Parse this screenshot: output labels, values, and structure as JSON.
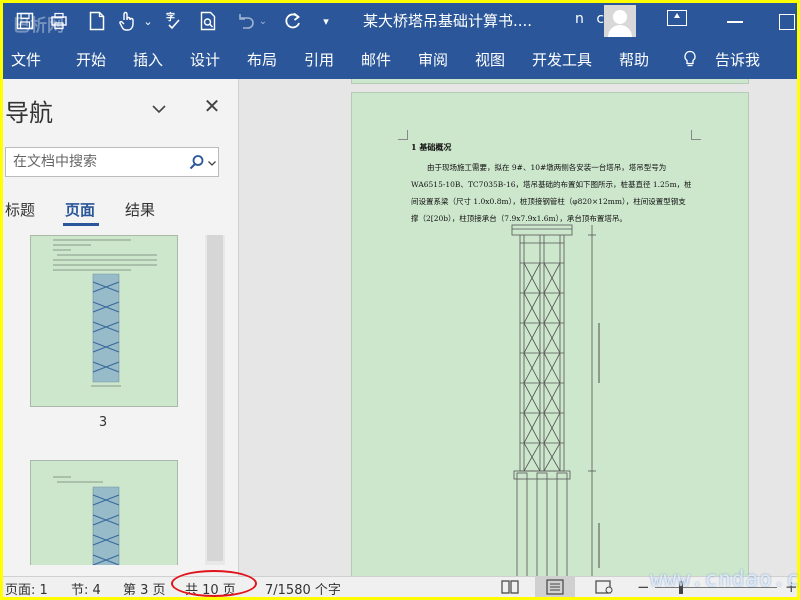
{
  "titlebar": {
    "doc_title": "某大桥塔吊基础计算书....",
    "user_name": "n c",
    "watermark_top": "巴析网"
  },
  "ribbon": {
    "tabs": [
      "文件",
      "开始",
      "插入",
      "设计",
      "布局",
      "引用",
      "邮件",
      "审阅",
      "视图",
      "开发工具",
      "帮助"
    ],
    "tell_me": "告诉我"
  },
  "nav": {
    "title": "导航",
    "search_placeholder": "在文档中搜索",
    "tabs": {
      "headings": "标题",
      "pages": "页面",
      "results": "结果"
    },
    "thumb_page_label": "3"
  },
  "document": {
    "section_heading": "1 基础概况",
    "para_lines": [
      "由于现场施工需要，拟在 9#、10#墩两侧各安装一台塔吊，塔吊型号为",
      "WA6515-10B、TC7035B-16，塔吊基础的布置如下图所示，桩基直径 1.25m，桩",
      "间设置系梁（尺寸 1.0x0.8m），桩顶接钢管柱（φ820×12mm），柱间设置型钢支",
      "撑（2[20b），柱顶接承台（7.9x7.9x1.6m），承台顶布置塔吊。"
    ]
  },
  "statusbar": {
    "page": "页面: 1",
    "section": "节: 4",
    "page_of": "第 3 页",
    "total_pages": "共 10 页",
    "word_count": "7/1580 个字"
  },
  "watermark": "www.cndao.com",
  "colors": {
    "ribbon_blue": "#2b579a",
    "page_green": "#cde7cd",
    "highlight_circle": "#e0141a",
    "screenshot_border": "#ffff00"
  }
}
